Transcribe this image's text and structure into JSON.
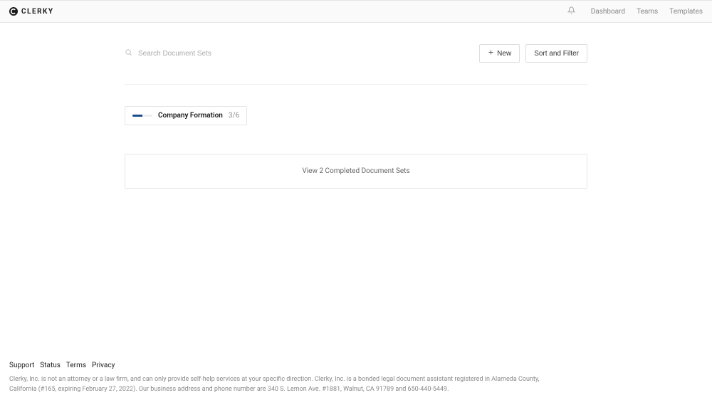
{
  "header": {
    "brand": "CLERKY",
    "nav": {
      "dashboard": "Dashboard",
      "teams": "Teams",
      "templates": "Templates"
    }
  },
  "toolbar": {
    "search_placeholder": "Search Document Sets",
    "new_label": "New",
    "sort_filter_label": "Sort and Filter"
  },
  "docset": {
    "title": "Company Formation",
    "progress_label": "3/6",
    "progress_pct": 50
  },
  "completed": {
    "label": "View 2 Completed Document Sets"
  },
  "footer": {
    "links": {
      "support": "Support",
      "status": "Status",
      "terms": "Terms",
      "privacy": "Privacy"
    },
    "disclaimer": "Clerky, Inc. is not an attorney or a law firm, and can only provide self-help services at your specific direction. Clerky, Inc. is a bonded legal document assistant registered in Alameda County, California (#165, expiring February 27, 2022). Our business address and phone number are 340 S. Lemon Ave. #1881, Walnut, CA 91789 and 650-440-5449."
  }
}
